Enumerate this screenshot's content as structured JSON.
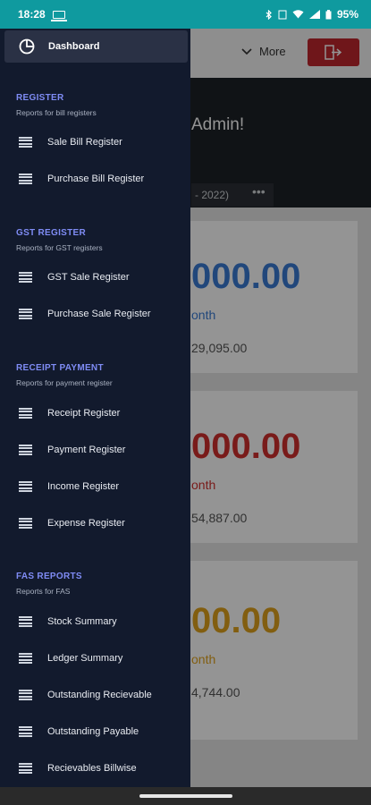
{
  "status": {
    "time": "18:28",
    "battery": "95%"
  },
  "background": {
    "more_label": "More",
    "welcome": "Admin!",
    "period": "- 2022)",
    "dots": "•••",
    "cards": [
      {
        "amount": "000.00",
        "month": "onth",
        "sub": "29,095.00",
        "color": "#3a7bd5"
      },
      {
        "amount": "000.00",
        "month": "onth",
        "sub": "54,887.00",
        "color": "#d0302e"
      },
      {
        "amount": "00.00",
        "month": "onth",
        "sub": "4,744.00",
        "color": "#e0a21c"
      }
    ]
  },
  "drawer": {
    "dashboard": {
      "label": "Dashboard",
      "icon": "pie-chart-icon"
    },
    "sections": [
      {
        "title": "REGISTER",
        "subtitle": "Reports for bill registers",
        "items": [
          "Sale Bill Register",
          "Purchase Bill Register"
        ]
      },
      {
        "title": "GST REGISTER",
        "subtitle": "Reports for GST registers",
        "items": [
          "GST Sale Register",
          "Purchase Sale Register"
        ]
      },
      {
        "title": "RECEIPT PAYMENT",
        "subtitle": "Reports for payment register",
        "items": [
          "Receipt Register",
          "Payment Register",
          "Income Register",
          "Expense Register"
        ]
      },
      {
        "title": "FAS REPORTS",
        "subtitle": "Reports for FAS",
        "items": [
          "Stock Summary",
          "Ledger Summary",
          "Outstanding Recievable",
          "Outstanding Payable",
          "Recievables Billwise"
        ]
      }
    ],
    "item_icon": "menu-lines-icon"
  },
  "colors": {
    "status_bar": "#0f9a9f",
    "drawer_bg": "#121a2d",
    "section_title": "#7f8cf5",
    "logout": "#c0262d"
  }
}
